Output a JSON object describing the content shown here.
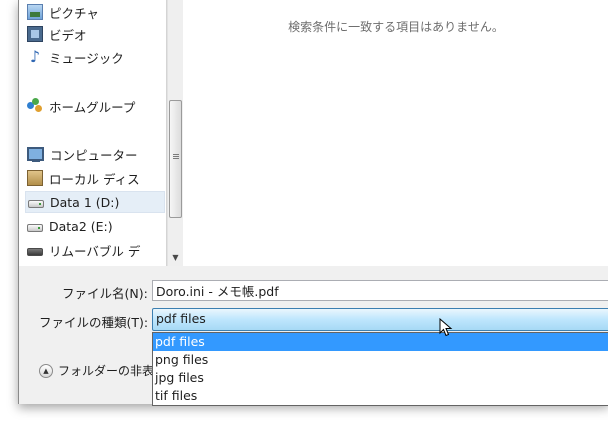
{
  "nav": {
    "items": [
      {
        "label": "ピクチャ",
        "icon": "pictures-icon"
      },
      {
        "label": "ビデオ",
        "icon": "videos-icon"
      },
      {
        "label": "ミュージック",
        "icon": "music-icon"
      },
      {
        "label": "ホームグループ",
        "icon": "homegroup-icon"
      },
      {
        "label": "コンピューター",
        "icon": "computer-icon"
      },
      {
        "label": "ローカル ディス",
        "icon": "local-disk-icon"
      },
      {
        "label": "Data 1 (D:)",
        "icon": "drive-icon"
      },
      {
        "label": "Data2 (E:)",
        "icon": "drive-icon"
      },
      {
        "label": "リムーバブル デ",
        "icon": "removable-drive-icon"
      }
    ]
  },
  "content": {
    "empty_message": "検索条件に一致する項目はありません。"
  },
  "form": {
    "filename_label": "ファイル名(N):",
    "filename_value": "Doro.ini - メモ帳.pdf",
    "filetype_label": "ファイルの種類(T):",
    "filetype_value": "pdf files",
    "filetype_options": [
      "pdf files",
      "png files",
      "jpg files",
      "tif files"
    ],
    "hide_folders_label": "フォルダーの非表"
  },
  "colors": {
    "selection": "#3399ff",
    "empty_message": "#6d6d6d"
  }
}
